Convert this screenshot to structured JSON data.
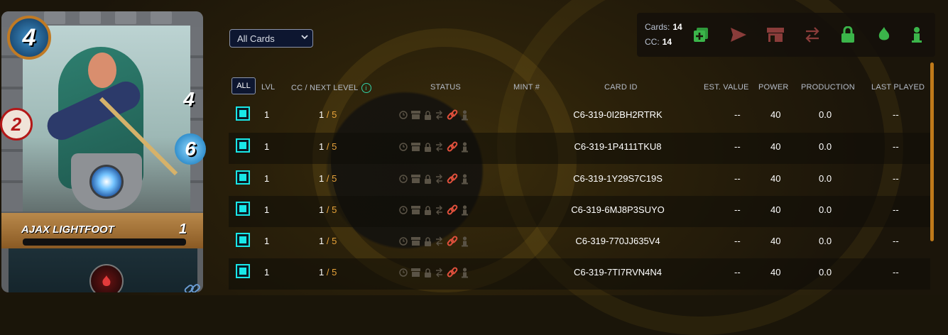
{
  "card": {
    "name": "AJAX LIGHTFOOT",
    "level": "1",
    "mana": "4",
    "health": "4",
    "speed": "6",
    "attack": "2",
    "element_icon": "fire-icon",
    "edition_icon": "chain-link-icon"
  },
  "filter": {
    "selected": "All Cards"
  },
  "summary": {
    "cards_label": "Cards:",
    "cards_value": "14",
    "cc_label": "CC:",
    "cc_value": "14"
  },
  "actions": [
    "combine-icon",
    "send-icon",
    "market-icon",
    "transfer-icon",
    "lock-icon",
    "burn-icon",
    "delegate-icon"
  ],
  "table": {
    "all_label": "ALL",
    "headers": {
      "lvl": "LVL",
      "cc": "CC / NEXT LEVEL",
      "status": "STATUS",
      "mint": "MINT #",
      "card_id": "CARD ID",
      "est_value": "EST. VALUE",
      "power": "POWER",
      "production": "PRODUCTION",
      "last_played": "LAST PLAYED"
    },
    "rows": [
      {
        "lvl": "1",
        "cc": "1",
        "next": "5",
        "card_id": "C6-319-0I2BH2RTRK",
        "est_value": "--",
        "power": "40",
        "production": "0.0",
        "last_played": "--"
      },
      {
        "lvl": "1",
        "cc": "1",
        "next": "5",
        "card_id": "C6-319-1P4111TKU8",
        "est_value": "--",
        "power": "40",
        "production": "0.0",
        "last_played": "--"
      },
      {
        "lvl": "1",
        "cc": "1",
        "next": "5",
        "card_id": "C6-319-1Y29S7C19S",
        "est_value": "--",
        "power": "40",
        "production": "0.0",
        "last_played": "--"
      },
      {
        "lvl": "1",
        "cc": "1",
        "next": "5",
        "card_id": "C6-319-6MJ8P3SUYO",
        "est_value": "--",
        "power": "40",
        "production": "0.0",
        "last_played": "--"
      },
      {
        "lvl": "1",
        "cc": "1",
        "next": "5",
        "card_id": "C6-319-770JJ635V4",
        "est_value": "--",
        "power": "40",
        "production": "0.0",
        "last_played": "--"
      },
      {
        "lvl": "1",
        "cc": "1",
        "next": "5",
        "card_id": "C6-319-7TI7RVN4N4",
        "est_value": "--",
        "power": "40",
        "production": "0.0",
        "last_played": "--"
      }
    ]
  },
  "colors": {
    "accent_cyan": "#19e7e8",
    "link_red": "#e0503c",
    "next_level": "#e8a33a",
    "action_green": "#3bb54a",
    "action_red": "#8a3c3a"
  }
}
